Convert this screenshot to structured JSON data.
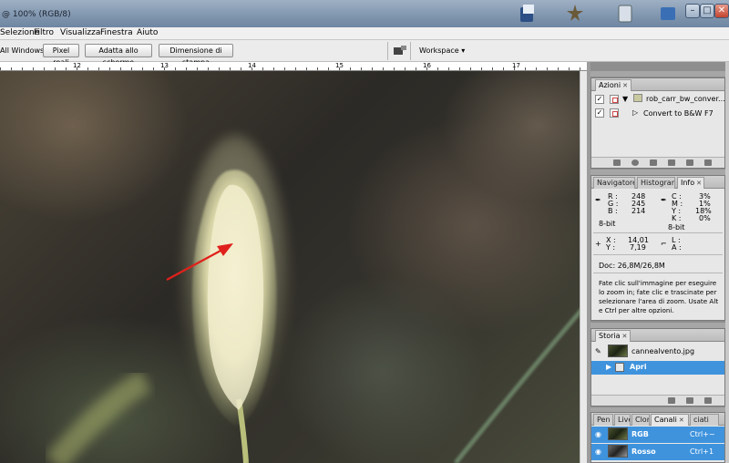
{
  "window": {
    "title": "@ 100% (RGB/8)",
    "controls": [
      "–",
      "□",
      "✕"
    ]
  },
  "menu": {
    "items": [
      "Selezione",
      "Filtro",
      "Visualizza",
      "Finestra",
      "Aiuto"
    ]
  },
  "options": {
    "all_windows": "All Windows",
    "buttons": [
      "Pixel reali",
      "Adatta allo schermo",
      "Dimensione di stampa"
    ],
    "workspace": "Workspace ▾"
  },
  "ruler": {
    "labels": [
      "12",
      "13",
      "14",
      "15",
      "16",
      "17"
    ]
  },
  "actions_panel": {
    "tab": "Azioni",
    "set_name": "rob_carr_bw_conver...",
    "action_name": "Convert to B&W",
    "shortcut": "F7"
  },
  "info_panel": {
    "tabs": [
      "Navigatore",
      "Histogram",
      "Info"
    ],
    "rgb": {
      "r_label": "R :",
      "g_label": "G :",
      "b_label": "B :",
      "r": "248",
      "g": "245",
      "b": "214"
    },
    "cmyk": {
      "c_label": "C :",
      "m_label": "M :",
      "y_label": "Y :",
      "k_label": "K :",
      "c": "3%",
      "m": "1%",
      "y": "18%",
      "k": "0%"
    },
    "bit_left": "8-bit",
    "bit_right": "8-bit",
    "xy": {
      "x_label": "X :",
      "y_label": "Y :",
      "x": "14,01",
      "y": "7,19"
    },
    "lw": {
      "l_label": "L :",
      "a_label": "A :"
    },
    "doc": "Doc: 26,8M/26,8M",
    "help": "Fate clic sull'immagine per eseguire lo zoom in; fate clic e trascinate per selezionare l'area di zoom. Usate Alt e Ctrl per altre opzioni."
  },
  "history_panel": {
    "tab": "Storia",
    "snapshot": "cannealvento.jpg",
    "step": "Apri"
  },
  "channels_panel": {
    "tabs": [
      "Pen",
      "Live",
      "Clor",
      "Canali",
      "ciati"
    ],
    "rows": [
      {
        "name": "RGB",
        "shortcut": "Ctrl+~"
      },
      {
        "name": "Rosso",
        "shortcut": "Ctrl+1"
      }
    ]
  },
  "colors": {
    "highlight": "#3f93dd",
    "arrow": "#e0211b"
  }
}
